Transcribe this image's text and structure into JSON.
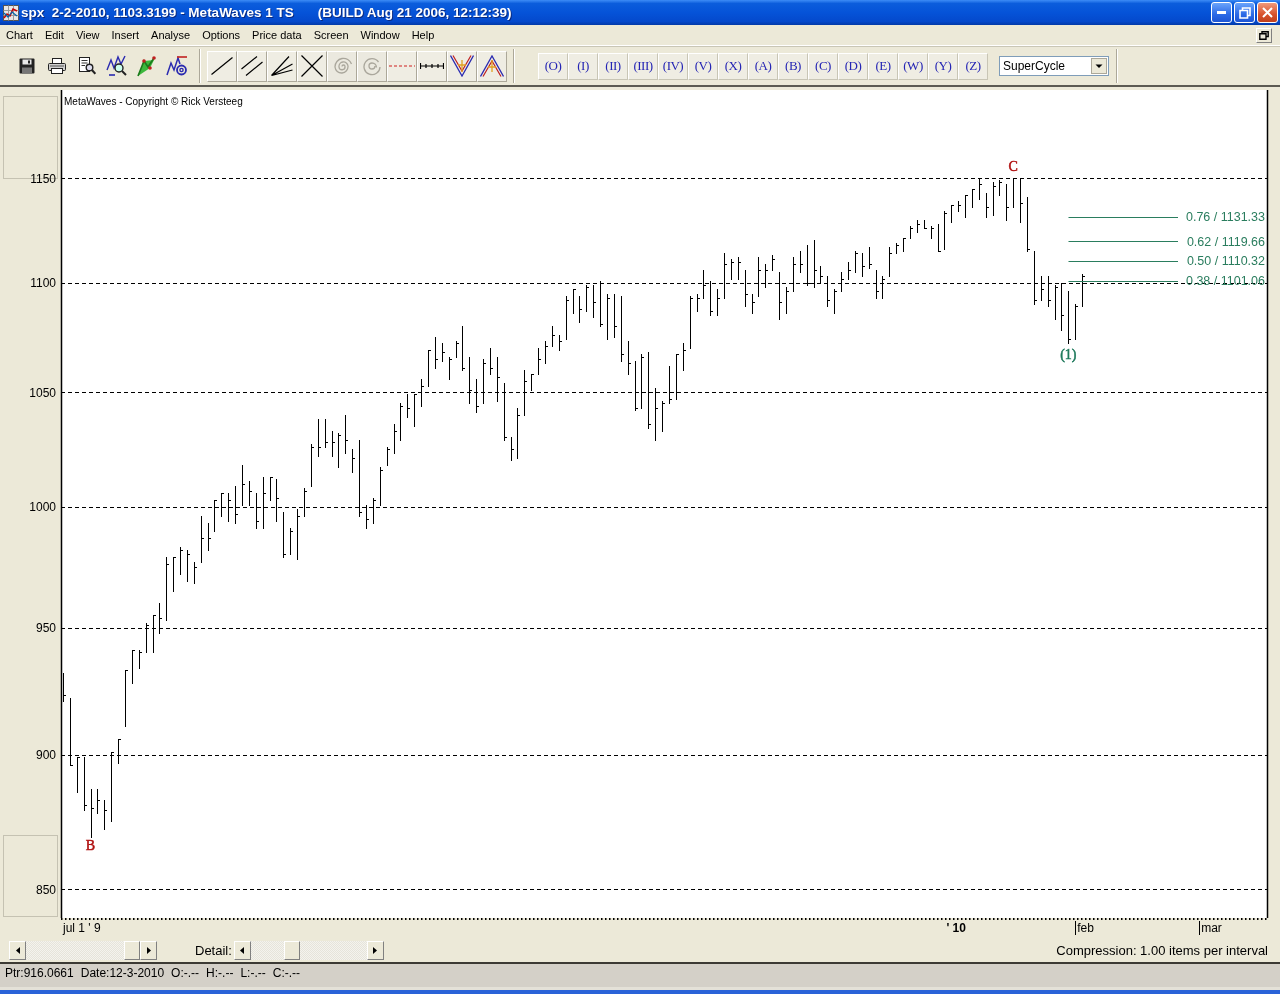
{
  "window": {
    "title": "spx  2-2-2010, 1103.3199 - MetaWaves 1 TS",
    "build": "(BUILD Aug 21 2006, 12:12:39)"
  },
  "menu": [
    "Chart",
    "Edit",
    "View",
    "Insert",
    "Analyse",
    "Options",
    "Price data",
    "Screen",
    "Window",
    "Help"
  ],
  "toolbar": {
    "drawing_tools": [
      {
        "kind": "line",
        "disabled": false
      },
      {
        "kind": "parallel",
        "disabled": false
      },
      {
        "kind": "fan",
        "disabled": false
      },
      {
        "kind": "cross",
        "disabled": false
      },
      {
        "kind": "spiral",
        "disabled": true
      },
      {
        "kind": "circles",
        "disabled": true
      },
      {
        "kind": "dashed",
        "disabled": false
      },
      {
        "kind": "ruler",
        "disabled": false
      },
      {
        "kind": "v-shape",
        "disabled": false
      },
      {
        "kind": "a-shape",
        "disabled": false
      }
    ],
    "wave_buttons": [
      "(O)",
      "(I)",
      "(II)",
      "(III)",
      "(IV)",
      "(V)",
      "(X)",
      "(A)",
      "(B)",
      "(C)",
      "(D)",
      "(E)",
      "(W)",
      "(Y)",
      "(Z)"
    ],
    "degree": {
      "value": "SuperCycle"
    }
  },
  "chart": {
    "caption": "MetaWaves - Copyright © Rick Versteeg",
    "y_axis_labels": [
      "1150",
      "1100",
      "1050",
      "1000",
      "950",
      "900",
      "850"
    ],
    "x_axis_labels": [
      {
        "kind": "start",
        "text": "jul 1 ' 9"
      },
      {
        "kind": "year",
        "text": "' 10"
      },
      {
        "kind": "month",
        "text": "feb"
      },
      {
        "kind": "month",
        "text": "mar"
      }
    ],
    "wave_labels": [
      {
        "text": "B",
        "color": "#b01010"
      },
      {
        "text": "C",
        "color": "#b01010"
      },
      {
        "text": "(1)",
        "color": "#1f7a5c"
      }
    ],
    "fib_levels": [
      "0.76 / 1131.33",
      "0.62 / 1119.66",
      "0.50 / 1110.32",
      "0.38 / 1101.06"
    ]
  },
  "scroll_row": {
    "detail_label": "Detail:",
    "compression": "Compression: 1.00 items per interval"
  },
  "status_bar": [
    "Ptr:916.0661",
    "Date:12-3-2010",
    "O:-.--",
    "H:-.--",
    "L:-.--",
    "C:-.--"
  ]
}
